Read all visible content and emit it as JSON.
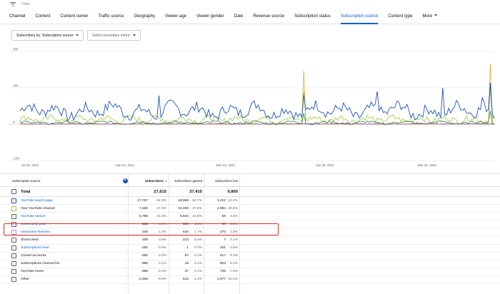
{
  "filter": {
    "placeholder": "Filter"
  },
  "tabs": [
    {
      "label": "Channel"
    },
    {
      "label": "Content"
    },
    {
      "label": "Content owner"
    },
    {
      "label": "Traffic source"
    },
    {
      "label": "Geography"
    },
    {
      "label": "Viewer age"
    },
    {
      "label": "Viewer gender"
    },
    {
      "label": "Date"
    },
    {
      "label": "Revenue source"
    },
    {
      "label": "Subscription status"
    },
    {
      "label": "Subscription source"
    },
    {
      "label": "Content type"
    },
    {
      "label": "More"
    }
  ],
  "active_tab": "Subscription source",
  "dropdowns": {
    "primary": "Subscribers by: Subscription source",
    "secondary": "Select secondary metric"
  },
  "chart_data": {
    "type": "line",
    "y_ticks": [
      "300",
      "150",
      "0",
      "-150"
    ],
    "ylim": [
      -150,
      300
    ],
    "x_ticks": [
      "Jul 25, 2021",
      "Sep 24, 2021",
      "Nov 23, 2021",
      "Jan 23, 2022",
      "Mar 25, 2022"
    ],
    "series_colors": [
      "#1c52b8",
      "#9bc83a",
      "#2f7d3c",
      "#8a3fa4",
      "#e3a92a"
    ]
  },
  "table": {
    "headers": {
      "source": "Subscription source",
      "subscribers": "Subscribers",
      "gained": "Subscribers gained",
      "lost": "Subscribers lost"
    },
    "total": {
      "label": "Total",
      "subscribers": "27,615",
      "gained": "37,415",
      "lost": "9,800"
    },
    "rows": [
      {
        "label": "YouTube watch page",
        "v1": "17,757",
        "p1": "64.3%",
        "v2": "18,969",
        "p2": "50.7%",
        "v3": "1,212",
        "p3": "12.4%",
        "link": true,
        "color": "c1"
      },
      {
        "label": "Your YouTube channel",
        "v1": "7,465",
        "p1": "27.0%",
        "v2": "10,459",
        "p2": "27.9%",
        "v3": "2,994",
        "p3": "30.6%",
        "link": false,
        "color": "c2"
      },
      {
        "label": "YouTube search",
        "v1": "5,786",
        "p1": "21.0%",
        "v2": "5,844",
        "p2": "15.6%",
        "v3": "58",
        "p3": "0.6%",
        "link": true,
        "color": "c3"
      },
      {
        "label": "Community post",
        "v1": "552",
        "p1": "2.0%",
        "v2": "609",
        "p2": "1.6%",
        "v3": "57",
        "p3": "0.6%",
        "link": true,
        "color": "c4"
      },
      {
        "label": "Interactive features",
        "v1": "346",
        "p1": "1.3%",
        "v2": "616",
        "p2": "1.7%",
        "v3": "270",
        "p3": "2.8%",
        "link": true,
        "color": "c5"
      },
      {
        "label": "Shorts feed",
        "v1": "206",
        "p1": "0.8%",
        "v2": "213",
        "p2": "0.6%",
        "v3": "7",
        "p3": "0.1%",
        "link": false,
        "color": ""
      },
      {
        "label": "Subscriptions feed",
        "v1": "-250",
        "p1": "-0.9%",
        "v2": "1",
        "p2": "0.0%",
        "v3": "251",
        "p3": "2.6%",
        "link": true,
        "color": ""
      },
      {
        "label": "Closed accounts",
        "v1": "-550",
        "p1": "-2.0%",
        "v2": "67",
        "p2": "0.2%",
        "v3": "617",
        "p3": "6.3%",
        "link": false,
        "color": ""
      },
      {
        "label": "Subscriptions channel list",
        "v1": "-585",
        "p1": "-2.1%",
        "v2": "18",
        "p2": "0.1%",
        "v3": "603",
        "p3": "6.2%",
        "link": false,
        "color": ""
      },
      {
        "label": "YouTube home",
        "v1": "-698",
        "p1": "-2.5%",
        "v2": "37",
        "p2": "0.1%",
        "v3": "735",
        "p3": "7.5%",
        "link": false,
        "color": ""
      },
      {
        "label": "Other",
        "v1": "-2,465",
        "p1": "-8.9%",
        "v2": "512",
        "p2": "1.4%",
        "v3": "2,977",
        "p3": "30.4%",
        "link": false,
        "color": ""
      }
    ]
  }
}
